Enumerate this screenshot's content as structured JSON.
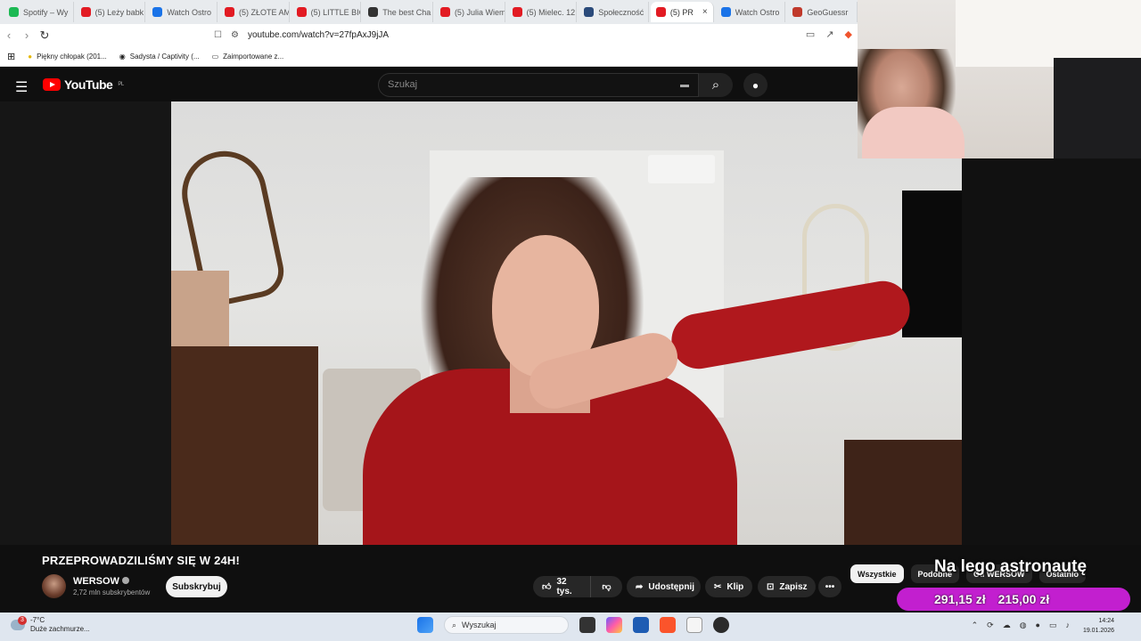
{
  "browser": {
    "tabs": [
      {
        "label": "Spotify – Wy",
        "color": "#1db954"
      },
      {
        "label": "(5) Leży babk",
        "color": "#e21b23"
      },
      {
        "label": "Watch Ostro",
        "color": "#1a73e8"
      },
      {
        "label": "(5) ZŁOTE AM",
        "color": "#e21b23"
      },
      {
        "label": "(5) LITTLE BIG",
        "color": "#e21b23"
      },
      {
        "label": "The best Cha",
        "color": "#333333"
      },
      {
        "label": "(5) Julia Wiem",
        "color": "#e21b23"
      },
      {
        "label": "(5) Mielec. 12",
        "color": "#e21b23"
      },
      {
        "label": "Społeczność",
        "color": "#2a4a7a"
      },
      {
        "label": "(5) PR",
        "color": "#e21b23",
        "active": true
      },
      {
        "label": "Watch Ostro",
        "color": "#1a73e8"
      },
      {
        "label": "GeoGuessr",
        "color": "#c0392b"
      }
    ],
    "url": "youtube.com/watch?v=27fpAxJ9jJA",
    "bookmarks": [
      "Piękny chłopak (201...",
      "Sadysta / Captivity (...",
      "Zaimportowane z..."
    ]
  },
  "youtube": {
    "logo": "YouTube",
    "region": "PL",
    "search_placeholder": "Szukaj",
    "video_title": "PRZEPROWADZILIŚMY SIĘ W 24H!",
    "channel_name": "WERSOW",
    "subscribers": "2,72 mln subskrybentów",
    "subscribe_label": "Subskrybuj",
    "likes": "32 tys.",
    "share_label": "Udostępnij",
    "clip_label": "Klip",
    "save_label": "Zapisz",
    "chips": [
      "Wszystkie",
      "Podobne",
      "Od WERSOW",
      "Ostatnio"
    ]
  },
  "overlay": {
    "caption": "Na lego astronautę",
    "amount_1": "291,15 zł",
    "amount_2": "215,00 zł",
    "accent": "#c21fcf"
  },
  "taskbar": {
    "weather_temp": "-7°C",
    "weather_desc": "Duże zachmurze...",
    "weather_badge": "3",
    "search_placeholder": "Wyszukaj",
    "time": "14:24",
    "date": "19.01.2026"
  }
}
